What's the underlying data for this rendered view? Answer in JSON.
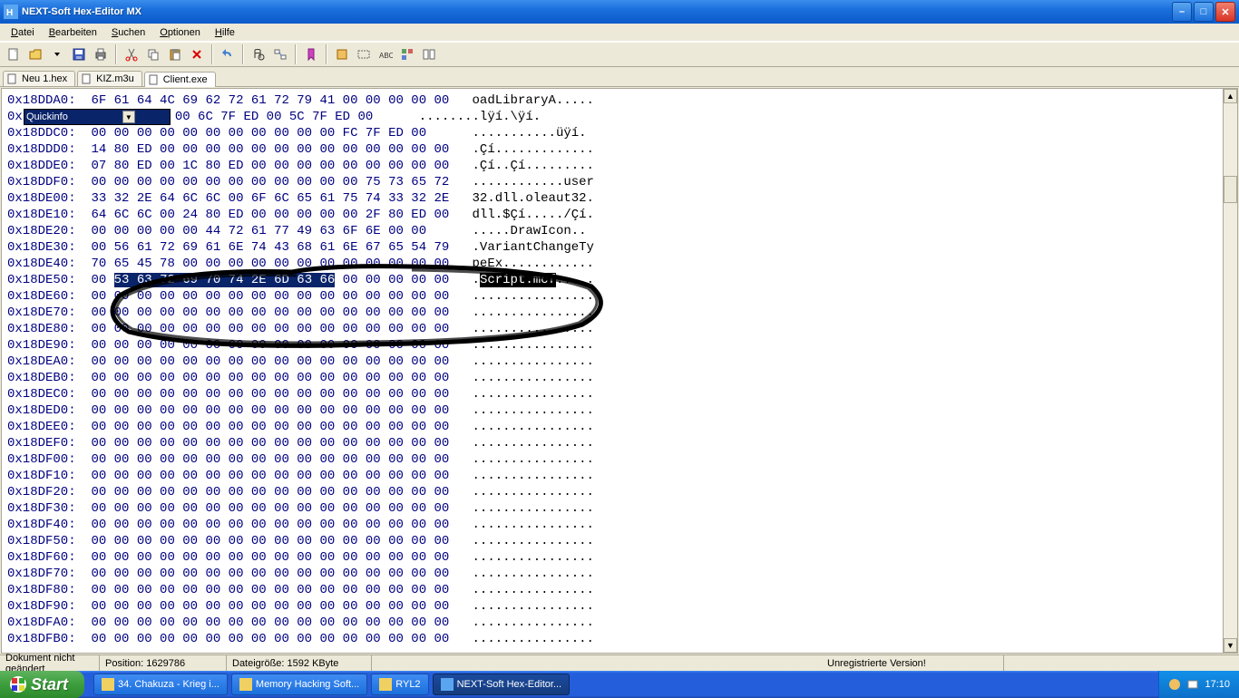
{
  "window": {
    "title": "NEXT-Soft Hex-Editor MX"
  },
  "menu": {
    "items": [
      "Datei",
      "Bearbeiten",
      "Suchen",
      "Optionen",
      "Hilfe"
    ]
  },
  "tabs": {
    "items": [
      "Neu 1.hex",
      "KIZ.m3u",
      "Client.exe"
    ],
    "active": 2
  },
  "quickinfo": {
    "label": "Quickinfo"
  },
  "status": {
    "doc": "Dokument nicht geändert",
    "pos_label": "Position:",
    "pos_val": "1629786",
    "size_label": "Dateigröße:",
    "size_val": "1592 KByte",
    "unreg": "Unregistrierte Version!"
  },
  "taskbar": {
    "start": "Start",
    "items": [
      {
        "label": "34. Chakuza - Krieg i...",
        "active": false
      },
      {
        "label": "Memory Hacking Soft...",
        "active": false
      },
      {
        "label": "RYL2",
        "active": false
      },
      {
        "label": "NEXT-Soft Hex-Editor...",
        "active": true
      }
    ],
    "clock": "17:10"
  },
  "hex": {
    "selected_ascii": "Script.mcf",
    "rows": [
      {
        "addr": "0x18DDA0:",
        "bytes": "6F 61 64 4C 69 62 72 61 72 79 41 00 00 00 00 00",
        "ascii": "oadLibraryA....."
      },
      {
        "addr": "0x",
        "bytes": "         00 00 00 00 6C 7F ED 00 5C 7F ED 00",
        "ascii": "........lÿí.\\ÿí."
      },
      {
        "addr": "0x18DDC0:",
        "bytes": "00 00 00 00 00 00 00 00 00 00 00 FC 7F ED 00",
        "ascii": "...........üÿí."
      },
      {
        "addr": "0x18DDD0:",
        "bytes": "14 80 ED 00 00 00 00 00 00 00 00 00 00 00 00 00",
        "ascii": ".Çí............."
      },
      {
        "addr": "0x18DDE0:",
        "bytes": "07 80 ED 00 1C 80 ED 00 00 00 00 00 00 00 00 00",
        "ascii": ".Çí..Çí........."
      },
      {
        "addr": "0x18DDF0:",
        "bytes": "00 00 00 00 00 00 00 00 00 00 00 00 75 73 65 72",
        "ascii": "............user"
      },
      {
        "addr": "0x18DE00:",
        "bytes": "33 32 2E 64 6C 6C 00 6F 6C 65 61 75 74 33 32 2E",
        "ascii": "32.dll.oleaut32."
      },
      {
        "addr": "0x18DE10:",
        "bytes": "64 6C 6C 00 24 80 ED 00 00 00 00 00 2F 80 ED 00",
        "ascii": "dll.$Çí...../Çí."
      },
      {
        "addr": "0x18DE20:",
        "bytes": "00 00 00 00 00 44 72 61 77 49 63 6F 6E 00 00",
        "ascii": ".....DrawIcon.."
      },
      {
        "addr": "0x18DE30:",
        "bytes": "00 56 61 72 69 61 6E 74 43 68 61 6E 67 65 54 79",
        "ascii": ".VariantChangeTy"
      },
      {
        "addr": "0x18DE40:",
        "bytes": "70 65 45 78 00 00 00 00 00 00 00 00 00 00 00 00",
        "ascii": "peEx............"
      },
      {
        "addr": "0x18DE50:",
        "bytes_pre": "00 ",
        "bytes_sel": "53 63 72 69 70 74 2E 6D 63 66",
        "bytes_post": " 00 00 00 00 00",
        "ascii_pre": ".",
        "ascii_sel": "Script.mcf",
        "ascii_post": "....."
      },
      {
        "addr": "0x18DE60:",
        "bytes": "00 00 00 00 00 00 00 00 00 00 00 00 00 00 00 00",
        "ascii": "................"
      },
      {
        "addr": "0x18DE70:",
        "bytes": "00 00 00 00 00 00 00 00 00 00 00 00 00 00 00 00",
        "ascii": "................"
      },
      {
        "addr": "0x18DE80:",
        "bytes": "00 00 00 00 00 00 00 00 00 00 00 00 00 00 00 00",
        "ascii": "................"
      },
      {
        "addr": "0x18DE90:",
        "bytes": "00 00 00 00 00 00 00 00 00 00 00 00 00 00 00 00",
        "ascii": "................"
      },
      {
        "addr": "0x18DEA0:",
        "bytes": "00 00 00 00 00 00 00 00 00 00 00 00 00 00 00 00",
        "ascii": "................"
      },
      {
        "addr": "0x18DEB0:",
        "bytes": "00 00 00 00 00 00 00 00 00 00 00 00 00 00 00 00",
        "ascii": "................"
      },
      {
        "addr": "0x18DEC0:",
        "bytes": "00 00 00 00 00 00 00 00 00 00 00 00 00 00 00 00",
        "ascii": "................"
      },
      {
        "addr": "0x18DED0:",
        "bytes": "00 00 00 00 00 00 00 00 00 00 00 00 00 00 00 00",
        "ascii": "................"
      },
      {
        "addr": "0x18DEE0:",
        "bytes": "00 00 00 00 00 00 00 00 00 00 00 00 00 00 00 00",
        "ascii": "................"
      },
      {
        "addr": "0x18DEF0:",
        "bytes": "00 00 00 00 00 00 00 00 00 00 00 00 00 00 00 00",
        "ascii": "................"
      },
      {
        "addr": "0x18DF00:",
        "bytes": "00 00 00 00 00 00 00 00 00 00 00 00 00 00 00 00",
        "ascii": "................"
      },
      {
        "addr": "0x18DF10:",
        "bytes": "00 00 00 00 00 00 00 00 00 00 00 00 00 00 00 00",
        "ascii": "................"
      },
      {
        "addr": "0x18DF20:",
        "bytes": "00 00 00 00 00 00 00 00 00 00 00 00 00 00 00 00",
        "ascii": "................"
      },
      {
        "addr": "0x18DF30:",
        "bytes": "00 00 00 00 00 00 00 00 00 00 00 00 00 00 00 00",
        "ascii": "................"
      },
      {
        "addr": "0x18DF40:",
        "bytes": "00 00 00 00 00 00 00 00 00 00 00 00 00 00 00 00",
        "ascii": "................"
      },
      {
        "addr": "0x18DF50:",
        "bytes": "00 00 00 00 00 00 00 00 00 00 00 00 00 00 00 00",
        "ascii": "................"
      },
      {
        "addr": "0x18DF60:",
        "bytes": "00 00 00 00 00 00 00 00 00 00 00 00 00 00 00 00",
        "ascii": "................"
      },
      {
        "addr": "0x18DF70:",
        "bytes": "00 00 00 00 00 00 00 00 00 00 00 00 00 00 00 00",
        "ascii": "................"
      },
      {
        "addr": "0x18DF80:",
        "bytes": "00 00 00 00 00 00 00 00 00 00 00 00 00 00 00 00",
        "ascii": "................"
      },
      {
        "addr": "0x18DF90:",
        "bytes": "00 00 00 00 00 00 00 00 00 00 00 00 00 00 00 00",
        "ascii": "................"
      },
      {
        "addr": "0x18DFA0:",
        "bytes": "00 00 00 00 00 00 00 00 00 00 00 00 00 00 00 00",
        "ascii": "................"
      },
      {
        "addr": "0x18DFB0:",
        "bytes": "00 00 00 00 00 00 00 00 00 00 00 00 00 00 00 00",
        "ascii": "................"
      }
    ]
  }
}
